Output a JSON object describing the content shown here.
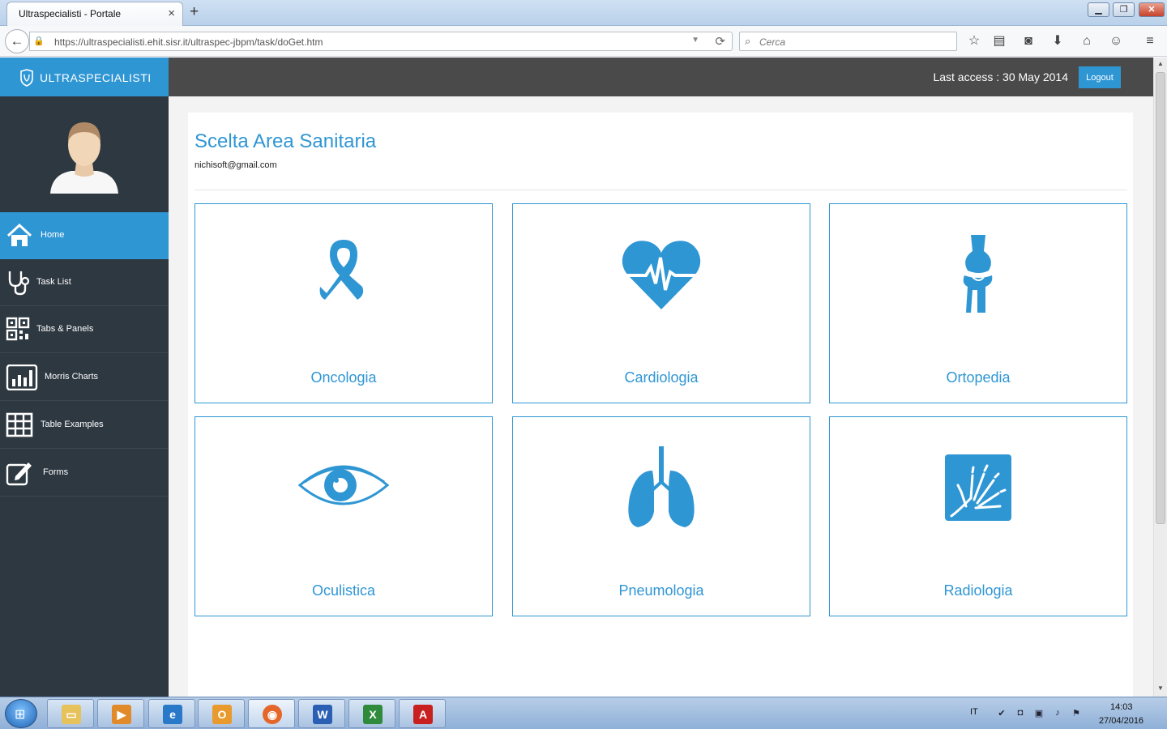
{
  "browser": {
    "tab_title": "Ultraspecialisti - Portale",
    "tab_close": "×",
    "new_tab": "+",
    "url": "https://ultraspecialisti.ehit.sisr.it/ultraspec-jbpm/task/doGet.htm",
    "search_placeholder": "Cerca"
  },
  "header": {
    "brand": "ULTRASPECIALISTI",
    "last_access": "Last access : 30 May 2014",
    "logout_label": "Logout"
  },
  "sidebar": {
    "items": [
      {
        "label": "Home",
        "icon": "home-icon",
        "active": true
      },
      {
        "label": "Task List",
        "icon": "stethoscope-icon",
        "active": false
      },
      {
        "label": "Tabs & Panels",
        "icon": "qr-code-icon",
        "active": false
      },
      {
        "label": "Morris Charts",
        "icon": "bar-chart-icon",
        "active": false
      },
      {
        "label": "Table Examples",
        "icon": "table-icon",
        "active": false
      },
      {
        "label": "Forms",
        "icon": "edit-icon",
        "active": false
      }
    ]
  },
  "main": {
    "title": "Scelta Area Sanitaria",
    "user_email": "nichisoft@gmail.com",
    "cards": [
      {
        "label": "Oncologia",
        "icon": "ribbon-icon"
      },
      {
        "label": "Cardiologia",
        "icon": "heartbeat-icon"
      },
      {
        "label": "Ortopedia",
        "icon": "knee-joint-icon"
      },
      {
        "label": "Oculistica",
        "icon": "eye-icon"
      },
      {
        "label": "Pneumologia",
        "icon": "lungs-icon"
      },
      {
        "label": "Radiologia",
        "icon": "xray-hand-icon"
      }
    ]
  },
  "taskbar": {
    "language": "IT",
    "time": "14:03",
    "date": "27/04/2016"
  },
  "colors": {
    "accent": "#2f96d4",
    "sidebar_bg": "#2e3841",
    "header_bg": "#4a4a4a"
  }
}
